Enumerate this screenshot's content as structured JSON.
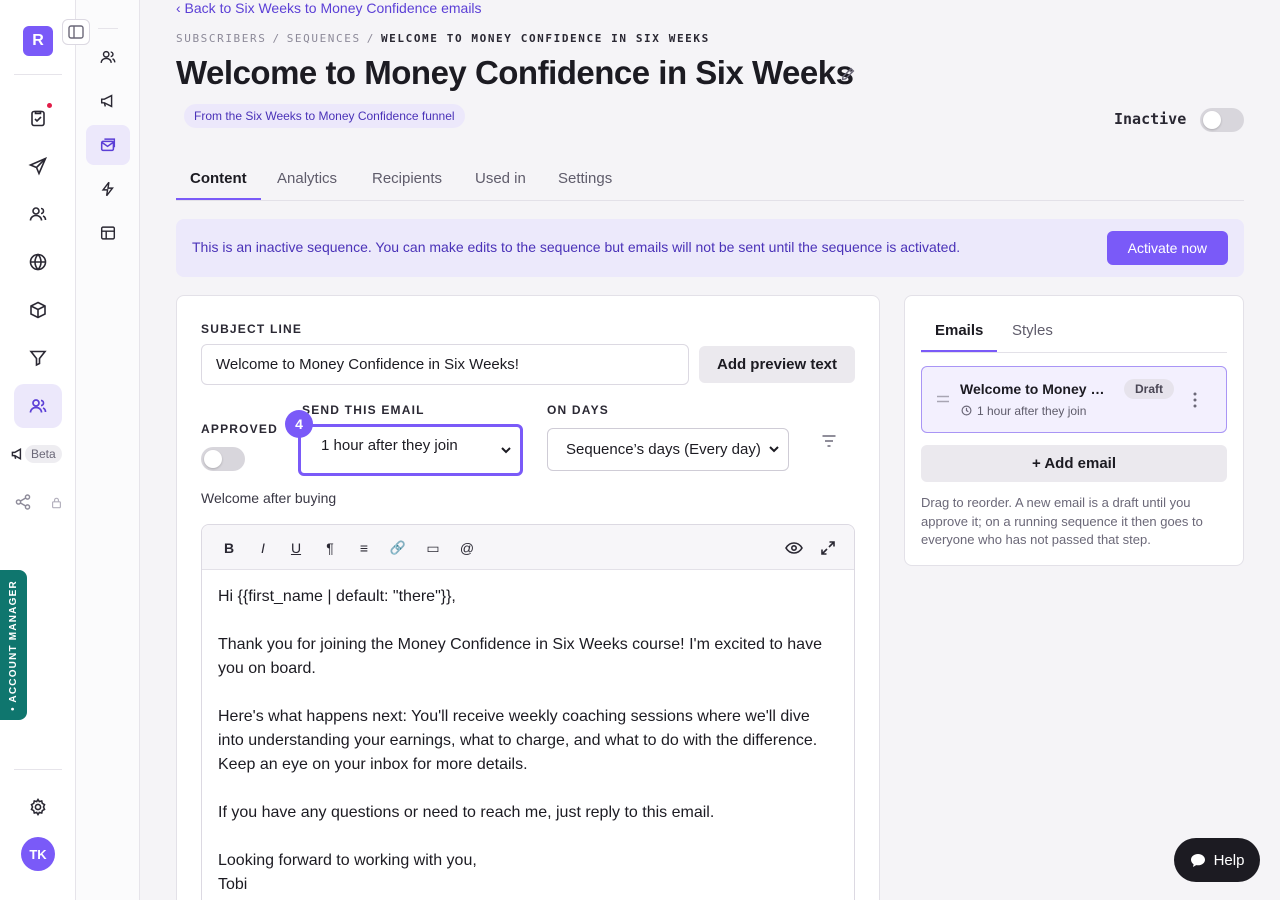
{
  "rail": {
    "logo": "R",
    "beta": "Beta",
    "account_manager": "• ACCOUNT MANAGER",
    "avatar": "TK"
  },
  "header": {
    "back": "‹ Back to Six Weeks to Money Confidence emails",
    "breadcrumbs": [
      "SUBSCRIBERS",
      "SEQUENCES",
      "WELCOME TO MONEY CONFIDENCE IN SIX WEEKS"
    ],
    "title": "Welcome to Money Confidence in Six Weeks",
    "funnel_badge": "From the Six Weeks to Money Confidence funnel",
    "status": "Inactive"
  },
  "tabs": [
    "Content",
    "Analytics",
    "Recipients",
    "Used in",
    "Settings"
  ],
  "notice": {
    "text": "This is an inactive sequence. You can make edits to the sequence but emails will not be sent until the sequence is activated.",
    "button": "Activate now"
  },
  "editor": {
    "subject_label": "SUBJECT LINE",
    "subject_value": "Welcome to Money Confidence in Six Weeks!",
    "preview_button": "Add preview text",
    "approved_label": "APPROVED",
    "send_label": "SEND THIS EMAIL",
    "send_value": "1 hour after they join",
    "step_badge": "4",
    "days_label": "ON DAYS",
    "days_value": "Sequence’s days (Every day)",
    "hint": "Welcome after buying",
    "toolbar": [
      "B",
      "I",
      "U",
      "¶",
      "≡",
      "🔗",
      "▭",
      "@"
    ],
    "body": [
      "Hi {{first_name | default: \"there\"}},",
      "",
      "Thank you for joining the Money Confidence in Six Weeks course! I'm excited to have you on board.",
      "",
      "Here's what happens next: You'll receive weekly coaching sessions where we'll dive into understanding your earnings, what to charge, and what to do with the difference. Keep an eye on your inbox for more details.",
      "",
      "If you have any questions or need to reach me, just reply to this email.",
      "",
      "Looking forward to working with you,",
      "Tobi"
    ]
  },
  "emails_panel": {
    "tabs": [
      "Emails",
      "Styles"
    ],
    "item": {
      "title": "Welcome to Money Confidence in Six Weeks",
      "status": "Draft",
      "timing": "1 hour after they join"
    },
    "add_button": "+ Add email",
    "note": "Drag to reorder. A new email is a draft until you approve it; on a running sequence it then goes to everyone who has not passed that step."
  },
  "help": "Help",
  "colors": {
    "accent": "#7a5af8",
    "notice_bg": "#ece9fb",
    "account_manager": "#0f766e"
  }
}
